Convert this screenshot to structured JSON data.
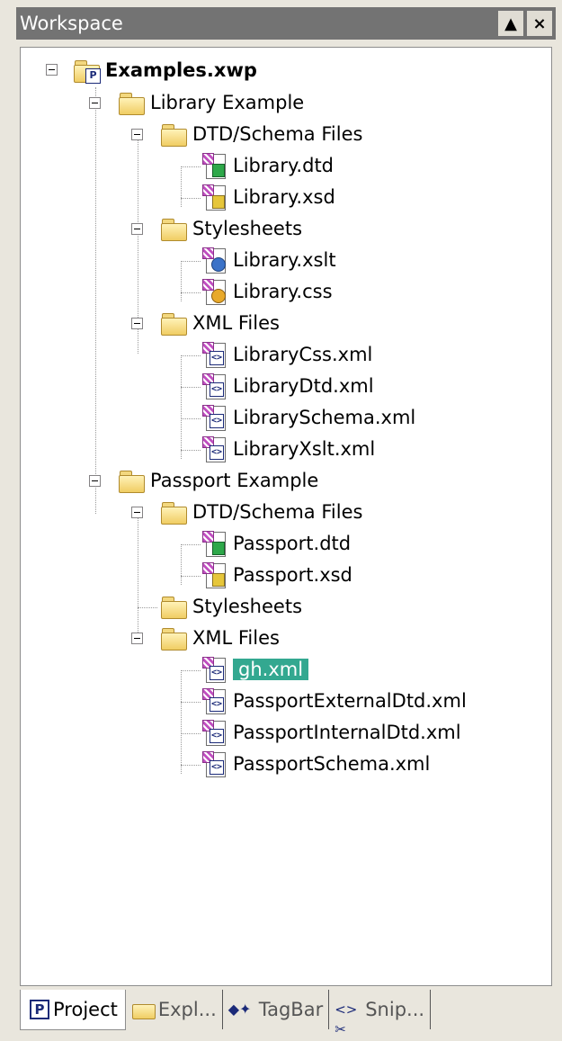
{
  "window": {
    "title": "Workspace",
    "pin_glyph": "▲",
    "close_glyph": "×"
  },
  "tree": {
    "root": "Examples.xwp",
    "items": [
      {
        "label": "Library Example",
        "icon": "folder-icon"
      },
      {
        "label": "DTD/Schema Files",
        "icon": "folder-icon"
      },
      {
        "label": "Library.dtd",
        "icon": "dtd-file-icon"
      },
      {
        "label": "Library.xsd",
        "icon": "xsd-file-icon"
      },
      {
        "label": "Stylesheets",
        "icon": "folder-icon"
      },
      {
        "label": "Library.xslt",
        "icon": "xslt-file-icon"
      },
      {
        "label": "Library.css",
        "icon": "css-file-icon"
      },
      {
        "label": "XML Files",
        "icon": "folder-icon"
      },
      {
        "label": "LibraryCss.xml",
        "icon": "xml-file-icon"
      },
      {
        "label": "LibraryDtd.xml",
        "icon": "xml-file-icon"
      },
      {
        "label": "LibrarySchema.xml",
        "icon": "xml-file-icon"
      },
      {
        "label": "LibraryXslt.xml",
        "icon": "xml-file-icon"
      },
      {
        "label": "Passport Example",
        "icon": "folder-icon"
      },
      {
        "label": "DTD/Schema Files",
        "icon": "folder-icon"
      },
      {
        "label": "Passport.dtd",
        "icon": "dtd-file-icon"
      },
      {
        "label": "Passport.xsd",
        "icon": "xsd-file-icon"
      },
      {
        "label": "Stylesheets",
        "icon": "folder-icon"
      },
      {
        "label": "XML Files",
        "icon": "folder-icon"
      },
      {
        "label": "gh.xml",
        "icon": "xml-file-icon"
      },
      {
        "label": "PassportExternalDtd.xml",
        "icon": "xml-file-icon"
      },
      {
        "label": "PassportInternalDtd.xml",
        "icon": "xml-file-icon"
      },
      {
        "label": "PassportSchema.xml",
        "icon": "xml-file-icon"
      }
    ],
    "selected": "gh.xml",
    "selection_color": "#33a890"
  },
  "tabs": {
    "project": "Project",
    "explorer": "Expl...",
    "tagbar": "TagBar",
    "snippets": "Snip..."
  }
}
